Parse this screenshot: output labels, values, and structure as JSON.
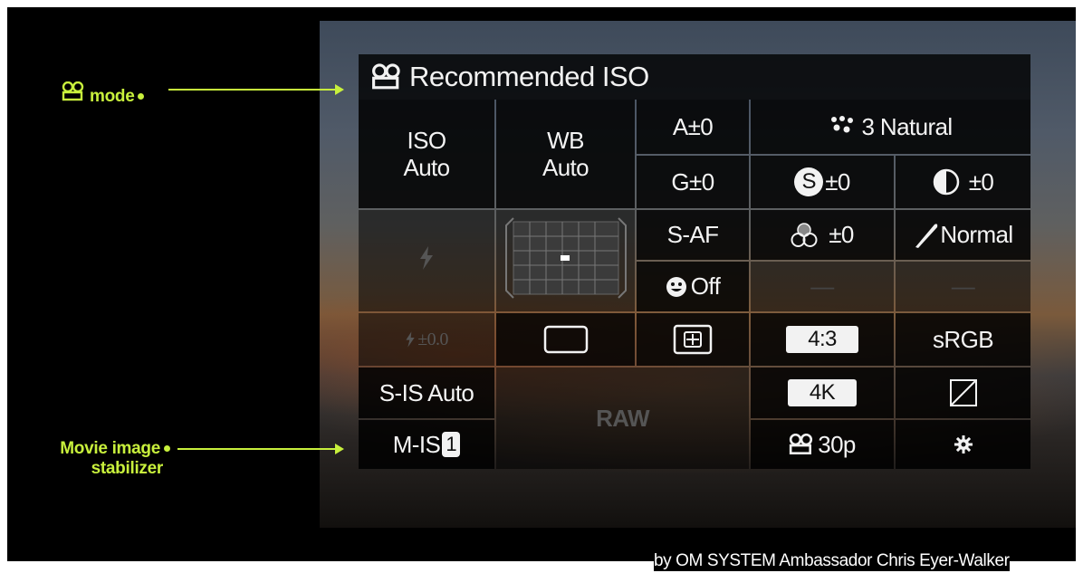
{
  "annotations": {
    "mode_label": "mode",
    "stabilizer_line1": "Movie image",
    "stabilizer_line2": "stabilizer"
  },
  "panel": {
    "title": "Recommended ISO",
    "iso_label": "ISO",
    "iso_value": "Auto",
    "wb_label": "WB",
    "wb_value": "Auto",
    "wb_a": "A±0",
    "wb_g": "G±0",
    "picture_mode": "3 Natural",
    "saturation": "±0",
    "contrast": "±0",
    "af_mode": "S-AF",
    "face_priority": "Off",
    "color_filter": "±0",
    "sharpness": "Normal",
    "dash1": "—",
    "dash2": "—",
    "flash_comp": "±0.0",
    "aspect": "4:3",
    "color_space": "sRGB",
    "image_stabilizer": "S-IS Auto",
    "raw": "RAW",
    "movie_res": "4K",
    "movie_is": "M-IS",
    "movie_is_level": "1",
    "frame_rate": "30p"
  },
  "credit": "by OM SYSTEM Ambassador Chris Eyer-Walker",
  "colors": {
    "annotation": "#c8f03c",
    "panel_bg": "#000000",
    "text": "#f4f4f4"
  },
  "icons": [
    "movie-camera-icon",
    "flash-icon",
    "af-target-icon",
    "face-icon",
    "metering-icon",
    "picture-mode-icon",
    "color-filter-icon",
    "sharpness-icon",
    "gradation-icon",
    "settings-gear-icon"
  ]
}
